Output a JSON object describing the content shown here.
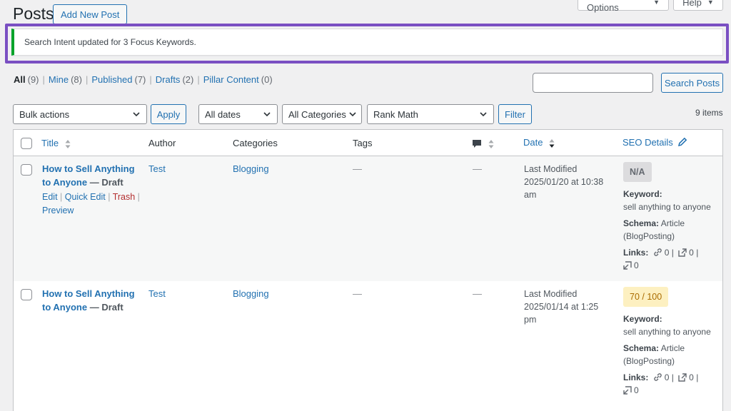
{
  "top": {
    "screen_options": "Screen Options",
    "help": "Help"
  },
  "header": {
    "title": "Posts",
    "add_new": "Add New Post"
  },
  "notice": {
    "text": "Search Intent updated for 3 Focus Keywords."
  },
  "views": [
    {
      "label": "All",
      "count": "(9)"
    },
    {
      "label": "Mine",
      "count": "(8)"
    },
    {
      "label": "Published",
      "count": "(7)"
    },
    {
      "label": "Drafts",
      "count": "(2)"
    },
    {
      "label": "Pillar Content",
      "count": "(0)"
    }
  ],
  "search": {
    "button": "Search Posts",
    "value": ""
  },
  "filters": {
    "bulk": "Bulk actions",
    "apply": "Apply",
    "dates": "All dates",
    "categories": "All Categories",
    "rankmath": "Rank Math",
    "filter": "Filter",
    "items": "9 items"
  },
  "columns": {
    "title": "Title",
    "author": "Author",
    "categories": "Categories",
    "tags": "Tags",
    "date": "Date",
    "seo": "SEO Details"
  },
  "rows": [
    {
      "title": "How to Sell Anything to Anyone",
      "title_line1": "How to Sell Anything",
      "title_line2": "to Anyone",
      "state": "— Draft",
      "actions": {
        "edit": "Edit",
        "quick_edit": "Quick Edit",
        "trash": "Trash",
        "preview": "Preview"
      },
      "author": "Test",
      "category": "Blogging",
      "tags": "—",
      "comments": "—",
      "date_status": "Last Modified",
      "date_line1": "2025/01/20 at 10:38",
      "date_line2": "am",
      "score": "N/A",
      "keyword_label": "Keyword:",
      "keyword": "sell anything to anyone",
      "schema_label": "Schema:",
      "schema_line1": "Article",
      "schema_line2": "(BlogPosting)",
      "links_label": "Links:",
      "internal": "0",
      "external": "0",
      "incoming": "0"
    },
    {
      "title": "How to Sell Anything to Anyone",
      "title_line1": "How to Sell Anything",
      "title_line2": "to Anyone",
      "state": "— Draft",
      "author": "Test",
      "category": "Blogging",
      "tags": "—",
      "comments": "—",
      "date_status": "Last Modified",
      "date_line1": "2025/01/14 at 1:25",
      "date_line2": "pm",
      "score": "70 / 100",
      "keyword_label": "Keyword:",
      "keyword": "sell anything to anyone",
      "schema_label": "Schema:",
      "schema_line1": "Article",
      "schema_line2": "(BlogPosting)",
      "links_label": "Links:",
      "internal": "0",
      "external": "0",
      "incoming": "0"
    }
  ],
  "colors": {
    "accent": "#2271b1",
    "notice_success": "#00a32a",
    "highlight": "#7a4fc2",
    "trash": "#b32d2e"
  }
}
